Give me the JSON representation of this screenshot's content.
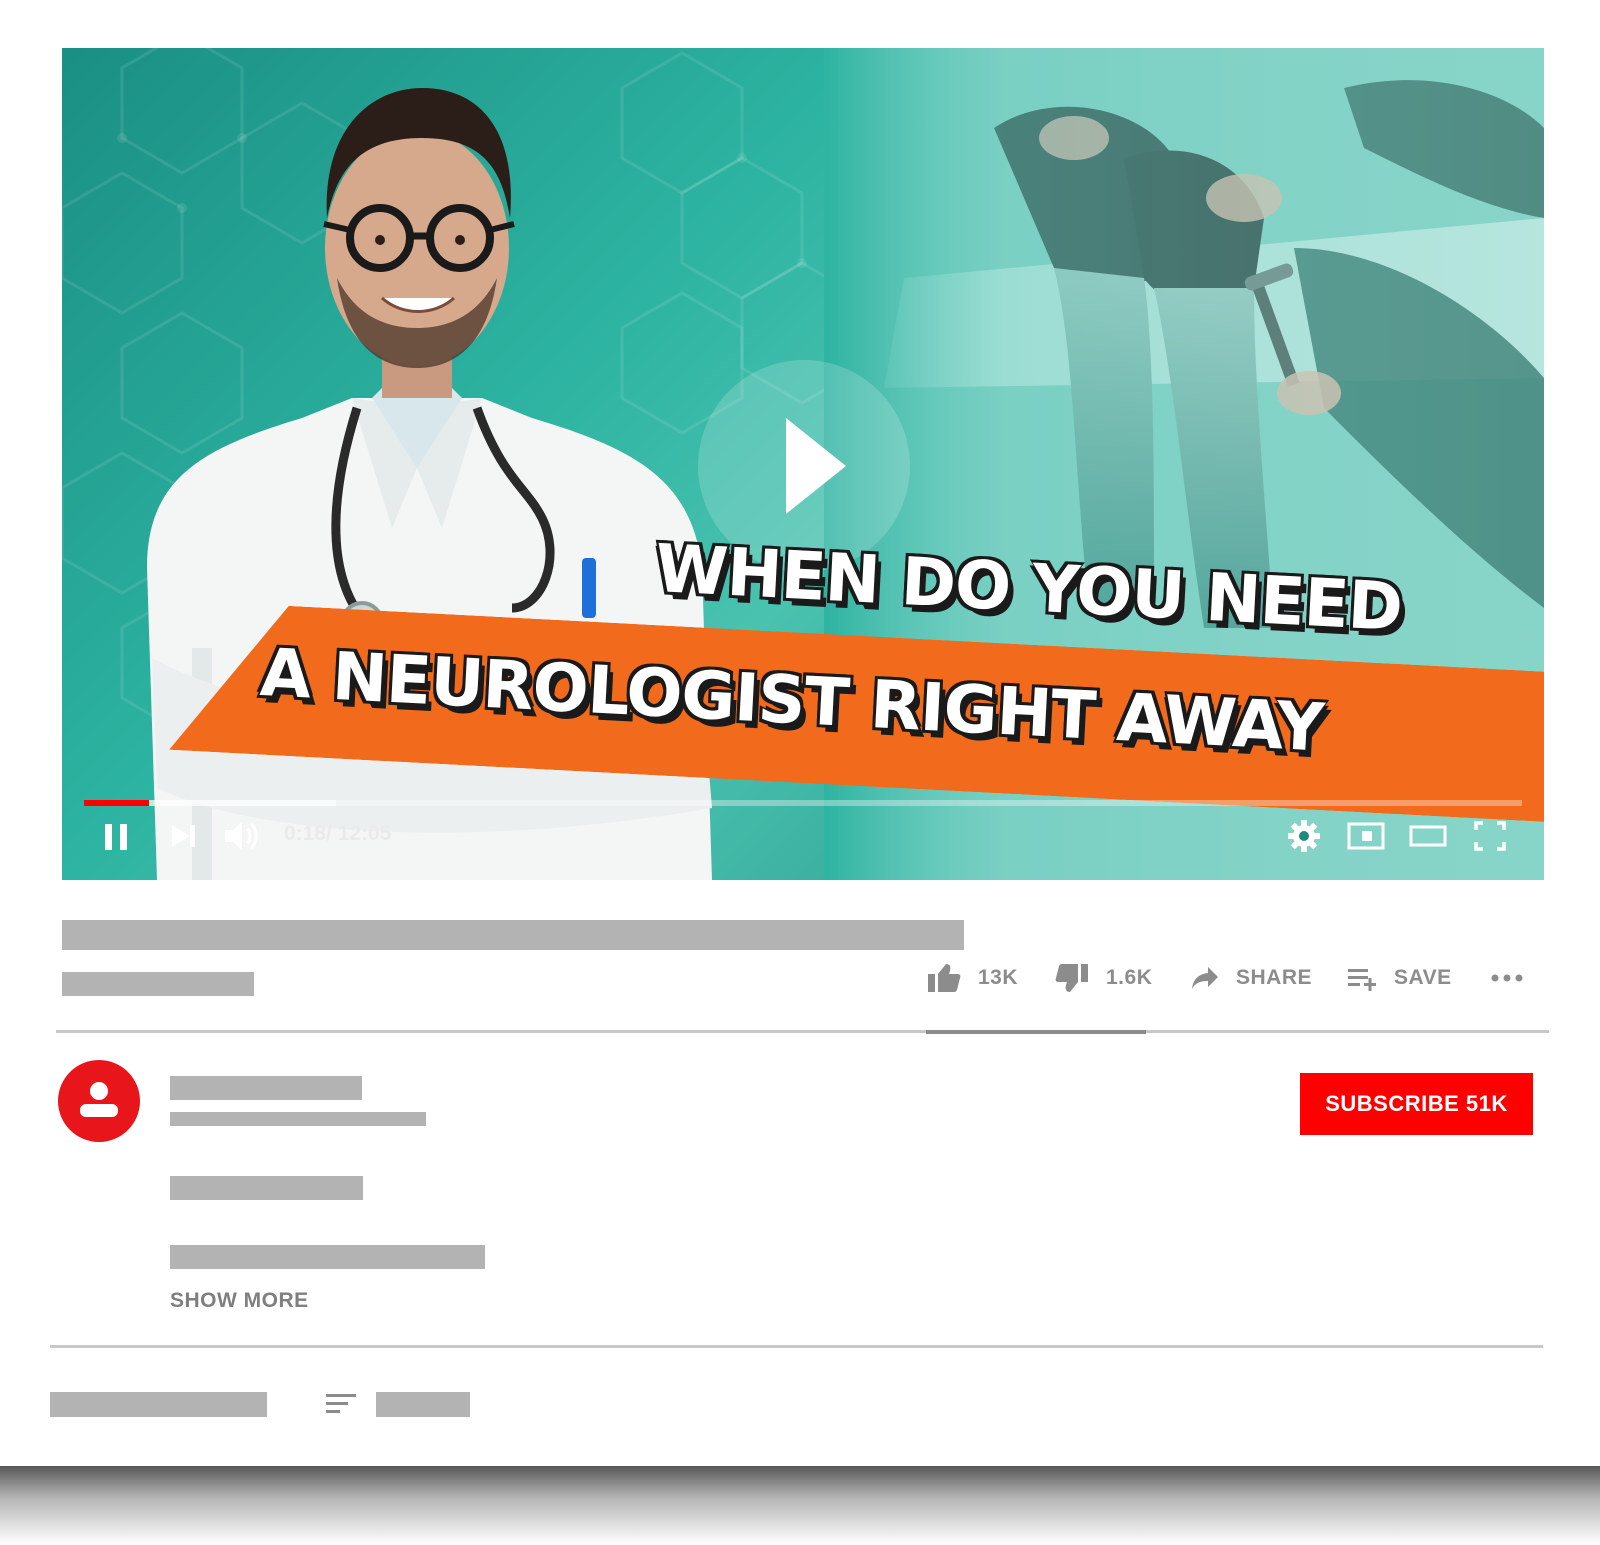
{
  "video": {
    "headline_line1": "WHEN DO YOU NEED",
    "headline_line2": "A NEUROLOGIST RIGHT AWAY",
    "time_display": "0:18/ 12:05",
    "progress_played_fraction": 0.045,
    "progress_buffered_fraction": 0.175,
    "colors": {
      "teal": "#2db3a1",
      "banner": "#f26a1b",
      "progress": "#ff0000"
    },
    "controls": [
      "pause-icon",
      "next-icon",
      "volume-icon",
      "settings-icon",
      "miniplayer-icon",
      "theater-mode-icon",
      "fullscreen-icon"
    ]
  },
  "actions": {
    "like_count": "13K",
    "dislike_count": "1.6K",
    "share_label": "SHARE",
    "save_label": "SAVE"
  },
  "channel": {
    "subscribe_label": "SUBSCRIBE 51K",
    "show_more_label": "SHOW MORE"
  }
}
